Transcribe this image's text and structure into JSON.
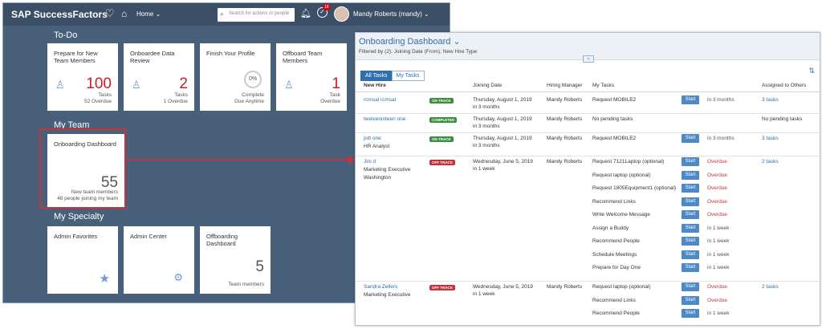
{
  "shell": {
    "brand": "SAP SuccessFactors",
    "home_label": "Home",
    "search_placeholder": "Search for actions or people",
    "notification_count": "18",
    "user": "Mandy Roberts (mandy)"
  },
  "sections": {
    "todo": "To-Do",
    "my_team": "My Team",
    "my_specialty": "My Specialty"
  },
  "todo_tiles": [
    {
      "title": "Prepare for New Team Members",
      "value": "100",
      "sub1": "Tasks",
      "sub2": "52 Overdue",
      "icon": "person-icon"
    },
    {
      "title": "Onboardee Data Review",
      "value": "2",
      "sub1": "Tasks",
      "sub2": "1 Overdue",
      "icon": "person-icon"
    },
    {
      "title": "Finish Your Profile",
      "value": "0%",
      "sub1": "Complete",
      "sub2": "Due Anytime",
      "icon": "progress-ring"
    },
    {
      "title": "Offboard Team Members",
      "value": "1",
      "sub1": "Task",
      "sub2": "Overdue",
      "icon": "person-icon"
    }
  ],
  "team_tile": {
    "title": "Onboarding Dashboard",
    "value": "55",
    "sub1": "New team members",
    "sub2": "48 people joining my team"
  },
  "specialty_tiles": [
    {
      "title": "Admin Favorites",
      "icon": "star-icon"
    },
    {
      "title": "Admin Center",
      "icon": "gear-icon"
    },
    {
      "title": "Offboarding Dashboard",
      "value": "5",
      "sub1": "Team members"
    }
  ],
  "dashboard": {
    "title": "Onboarding Dashboard",
    "filter": "Filtered by (2): Joining Date (From), New Hire Type",
    "tabs": [
      "All Tasks",
      "My Tasks"
    ],
    "columns": [
      "New Hire",
      "Joining Date",
      "Hiring Manager",
      "My Tasks",
      "Assigned to Others"
    ],
    "start_label": "Start",
    "rows": [
      {
        "name": "rcmsal rcmsal",
        "role": "",
        "location": "",
        "status": "ON TRACK",
        "status_color": "#3b8d3f",
        "date": "Thursday, August 1, 2019",
        "date_rel": "in 3 months",
        "manager": "Mandy Roberts",
        "others": "3 tasks",
        "tasks": [
          {
            "name": "Request MOBILE2",
            "due": "in 3 months",
            "overdue": false
          }
        ]
      },
      {
        "name": "twelveninteen one",
        "role": "",
        "location": "",
        "status": "COMPLETED",
        "status_color": "#3b8d3f",
        "date": "Thursday, August 1, 2019",
        "date_rel": "in 3 months",
        "manager": "Mandy Roberts",
        "others": "No pending tasks",
        "tasks": [
          {
            "name": "No pending tasks",
            "due": "",
            "overdue": false,
            "no_button": true
          }
        ]
      },
      {
        "name": "pdt one",
        "role": "HR Analyst",
        "location": "",
        "status": "ON TRACK",
        "status_color": "#3b8d3f",
        "date": "Thursday, August 1, 2019",
        "date_rel": "in 3 months",
        "manager": "Mandy Roberts",
        "others": "3 tasks",
        "tasks": [
          {
            "name": "Request MOBILE2",
            "due": "in 3 months",
            "overdue": false
          }
        ]
      },
      {
        "name": "Jini d",
        "role": "Marketing Executive",
        "location": "Washington",
        "status": "OFF TRACK",
        "status_color": "#c8323a",
        "date": "Wednesday, June 5, 2019",
        "date_rel": "in 1 week",
        "manager": "Mandy Roberts",
        "others": "2 tasks",
        "tasks": [
          {
            "name": "Request 7121Laptop (optional)",
            "due": "Overdue",
            "overdue": true
          },
          {
            "name": "Request laptop (optional)",
            "due": "Overdue",
            "overdue": true
          },
          {
            "name": "Request 1805Equipment1 (optional)",
            "due": "Overdue",
            "overdue": true
          },
          {
            "name": "Recommend Links",
            "due": "Overdue",
            "overdue": true
          },
          {
            "name": "Write Welcome Message",
            "due": "Overdue",
            "overdue": true
          },
          {
            "name": "Assign a Buddy",
            "due": "in 1 week",
            "overdue": false
          },
          {
            "name": "Recommend People",
            "due": "in 1 week",
            "overdue": false
          },
          {
            "name": "Schedule Meetings",
            "due": "in 1 week",
            "overdue": false
          },
          {
            "name": "Prepare for Day One",
            "due": "in 1 week",
            "overdue": false
          }
        ]
      },
      {
        "name": "Sandra Zellers",
        "role": "Marketing Executive",
        "location": "",
        "status": "OFF TRACK",
        "status_color": "#c8323a",
        "date": "Wednesday, June 5, 2019",
        "date_rel": "in 1 week",
        "manager": "Mandy Roberts",
        "others": "2 tasks",
        "tasks": [
          {
            "name": "Request laptop (optional)",
            "due": "Overdue",
            "overdue": true
          },
          {
            "name": "Recommend Links",
            "due": "Overdue",
            "overdue": true
          },
          {
            "name": "Recommend People",
            "due": "in 1 week",
            "overdue": false
          }
        ]
      }
    ]
  },
  "colors": {
    "shell": "#3b5066",
    "background": "#49607a",
    "accent": "#2e6faf",
    "danger": "#c8323a",
    "success": "#3b8d3f"
  }
}
